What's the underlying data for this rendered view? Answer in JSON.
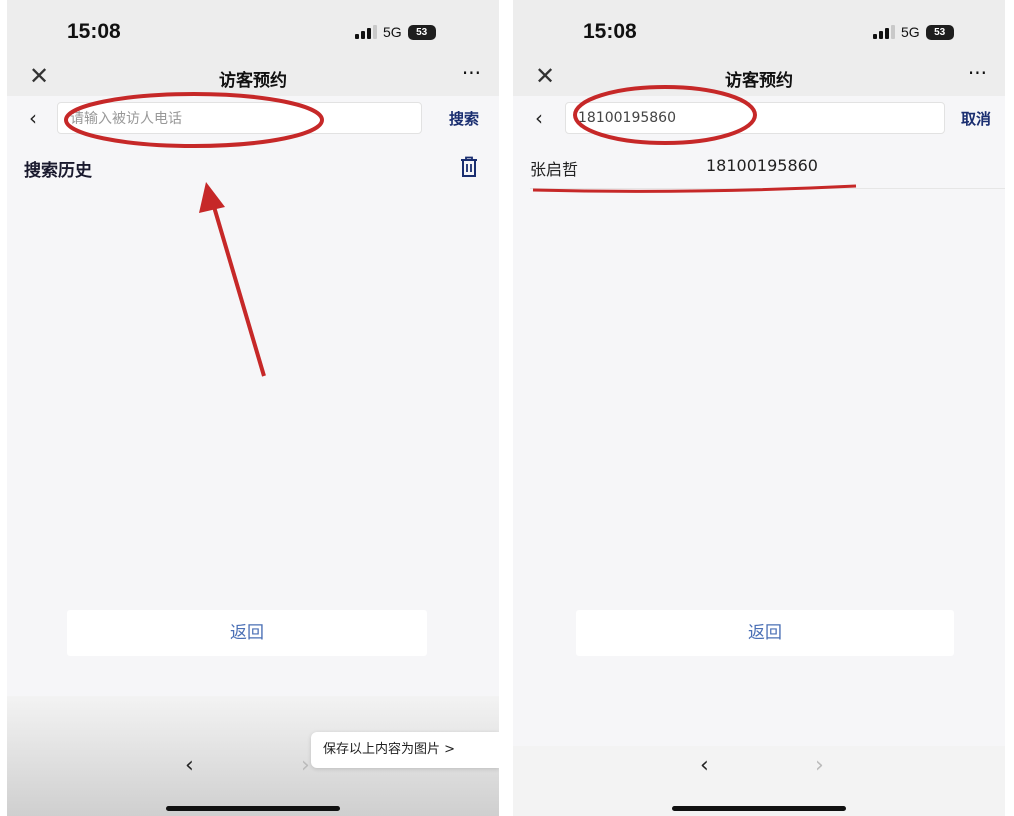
{
  "left": {
    "status": {
      "time": "15:08",
      "network": "5G",
      "battery": "53"
    },
    "nav": {
      "close_icon": "✕",
      "title": "访客预约",
      "more": "···"
    },
    "search": {
      "back_icon": "‹",
      "placeholder": "请输入被访人电话",
      "action_label": "搜索"
    },
    "history": {
      "title": "搜索历史"
    },
    "back_button_label": "返回",
    "bottom": {
      "prev": "‹",
      "next": "›"
    },
    "toast": "保存以上内容为图片 >"
  },
  "right": {
    "status": {
      "time": "15:08",
      "network": "5G",
      "battery": "53"
    },
    "nav": {
      "close_icon": "✕",
      "title": "访客预约",
      "more": "···"
    },
    "search": {
      "back_icon": "‹",
      "value": "18100195860",
      "action_label": "取消"
    },
    "result": {
      "name": "张启哲",
      "phone": "18100195860"
    },
    "back_button_label": "返回",
    "bottom": {
      "prev": "‹",
      "next": "›"
    }
  },
  "annotation_color": "#c62828"
}
